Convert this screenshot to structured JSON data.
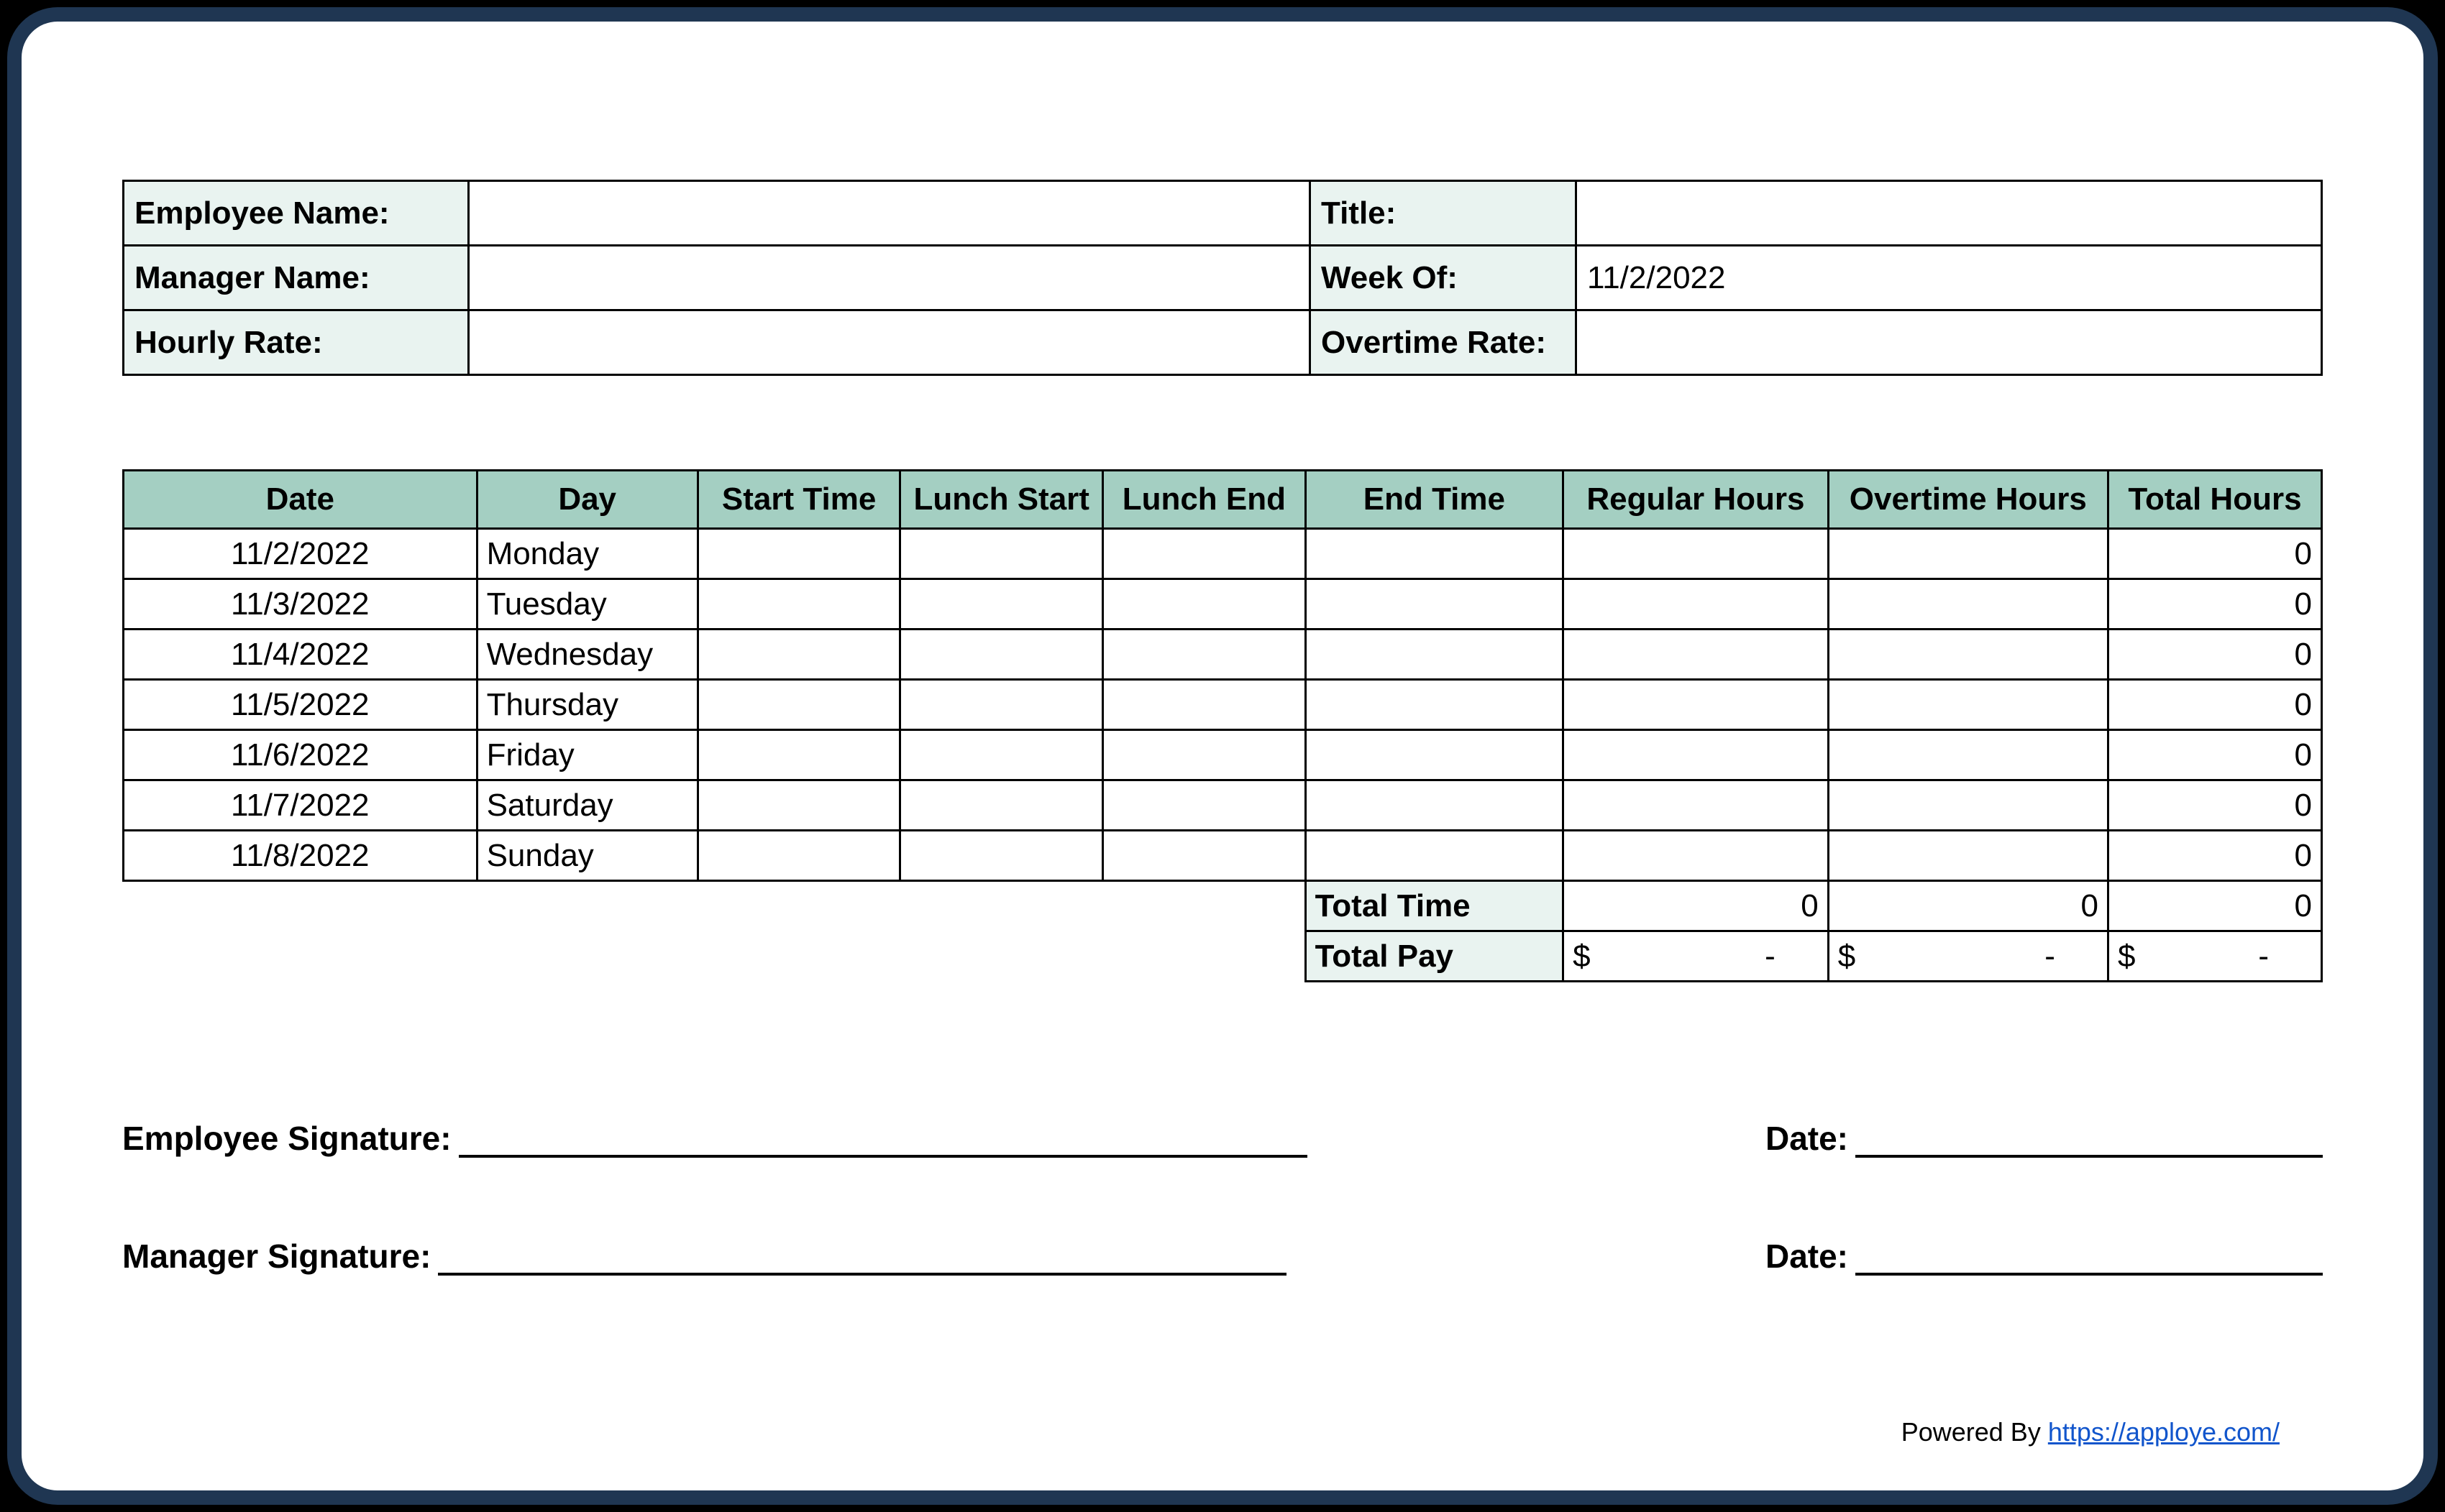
{
  "info": {
    "employee_name_label": "Employee Name:",
    "employee_name_value": "",
    "title_label": "Title:",
    "title_value": "",
    "manager_name_label": "Manager Name:",
    "manager_name_value": "",
    "week_of_label": "Week Of:",
    "week_of_value": "11/2/2022",
    "hourly_rate_label": "Hourly Rate:",
    "hourly_rate_value": "",
    "overtime_rate_label": "Overtime Rate:",
    "overtime_rate_value": ""
  },
  "columns": {
    "date": "Date",
    "day": "Day",
    "start": "Start Time",
    "lunch_start": "Lunch Start",
    "lunch_end": "Lunch End",
    "end": "End Time",
    "regular": "Regular Hours",
    "overtime": "Overtime Hours",
    "total": "Total Hours"
  },
  "rows": [
    {
      "date": "11/2/2022",
      "day": "Monday",
      "start": "",
      "lunch_start": "",
      "lunch_end": "",
      "end": "",
      "regular": "",
      "overtime": "",
      "total": "0"
    },
    {
      "date": "11/3/2022",
      "day": "Tuesday",
      "start": "",
      "lunch_start": "",
      "lunch_end": "",
      "end": "",
      "regular": "",
      "overtime": "",
      "total": "0"
    },
    {
      "date": "11/4/2022",
      "day": "Wednesday",
      "start": "",
      "lunch_start": "",
      "lunch_end": "",
      "end": "",
      "regular": "",
      "overtime": "",
      "total": "0"
    },
    {
      "date": "11/5/2022",
      "day": "Thursday",
      "start": "",
      "lunch_start": "",
      "lunch_end": "",
      "end": "",
      "regular": "",
      "overtime": "",
      "total": "0"
    },
    {
      "date": "11/6/2022",
      "day": "Friday",
      "start": "",
      "lunch_start": "",
      "lunch_end": "",
      "end": "",
      "regular": "",
      "overtime": "",
      "total": "0"
    },
    {
      "date": "11/7/2022",
      "day": "Saturday",
      "start": "",
      "lunch_start": "",
      "lunch_end": "",
      "end": "",
      "regular": "",
      "overtime": "",
      "total": "0"
    },
    {
      "date": "11/8/2022",
      "day": "Sunday",
      "start": "",
      "lunch_start": "",
      "lunch_end": "",
      "end": "",
      "regular": "",
      "overtime": "",
      "total": "0"
    }
  ],
  "totals": {
    "total_time_label": "Total Time",
    "total_time_regular": "0",
    "total_time_overtime": "0",
    "total_time_total": "0",
    "total_pay_label": "Total Pay",
    "currency": "$",
    "dash": "-"
  },
  "signatures": {
    "employee_label": "Employee Signature:",
    "manager_label": "Manager Signature:",
    "date_label": "Date:"
  },
  "footer": {
    "prefix": "Powered By ",
    "link_text": "https://apploye.com/"
  }
}
